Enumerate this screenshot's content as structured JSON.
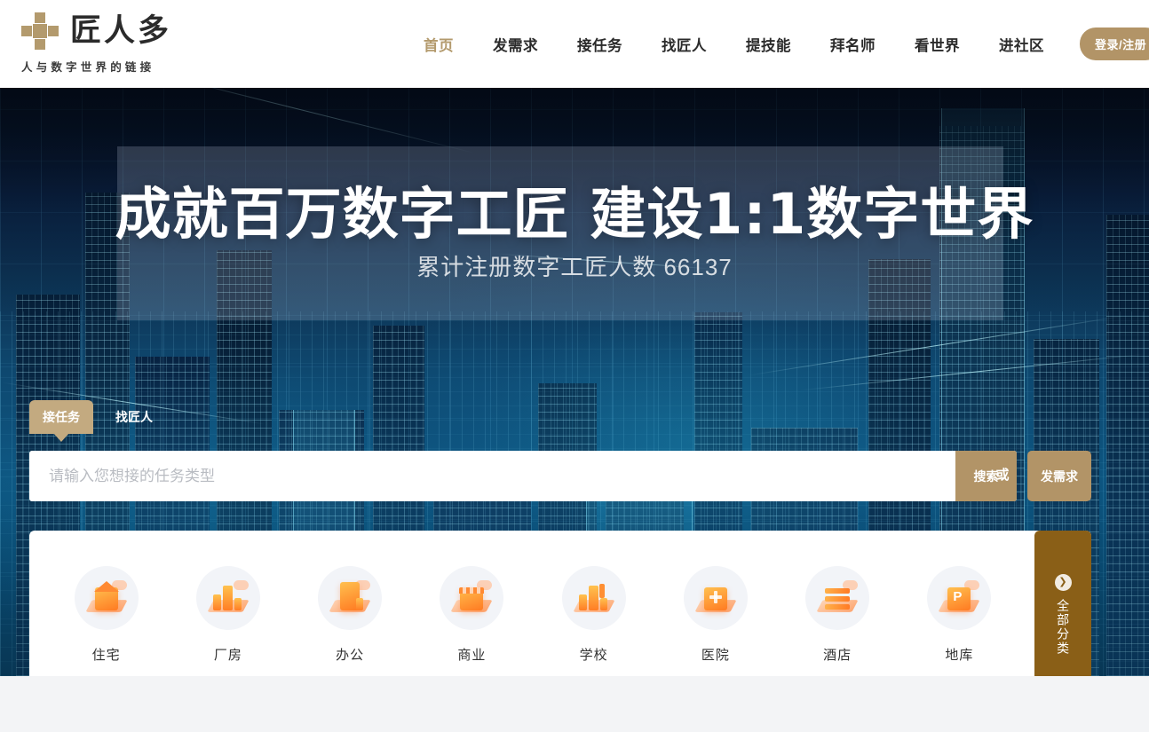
{
  "header": {
    "logo": {
      "name": "匠人多",
      "tagline": "人与数字世界的链接",
      "mark_icon": "cross-blocks-icon"
    },
    "nav": [
      {
        "label": "首页",
        "active": true
      },
      {
        "label": "发需求",
        "active": false
      },
      {
        "label": "接任务",
        "active": false
      },
      {
        "label": "找匠人",
        "active": false
      },
      {
        "label": "提技能",
        "active": false
      },
      {
        "label": "拜名师",
        "active": false
      },
      {
        "label": "看世界",
        "active": false
      },
      {
        "label": "进社区",
        "active": false
      }
    ],
    "login_button": "登录/注册"
  },
  "hero": {
    "title": "成就百万数字工匠  建设1:1数字世界",
    "subtitle": "累计注册数字工匠人数 66137",
    "registered_count": "66137"
  },
  "search": {
    "tabs": [
      {
        "label": "接任务",
        "active": true
      },
      {
        "label": "找匠人",
        "active": false
      }
    ],
    "placeholder": "请输入您想接的任务类型",
    "value": "",
    "search_button": "搜索",
    "or_text": "或",
    "demand_button": "发需求"
  },
  "categories": {
    "items": [
      {
        "label": "住宅",
        "icon": "house-icon"
      },
      {
        "label": "厂房",
        "icon": "factory-icon"
      },
      {
        "label": "办公",
        "icon": "office-icon"
      },
      {
        "label": "商业",
        "icon": "shop-icon"
      },
      {
        "label": "学校",
        "icon": "school-icon"
      },
      {
        "label": "医院",
        "icon": "hospital-icon"
      },
      {
        "label": "酒店",
        "icon": "hotel-icon"
      },
      {
        "label": "地库",
        "icon": "parking-icon"
      }
    ],
    "all_label": "全部分类",
    "all_icon": "chevron-right-circle-icon"
  },
  "colors": {
    "brand_gold": "#b29467",
    "tab_gold": "#c3aa80",
    "all_brown": "#8a5f17",
    "page_bg": "#f3f4f6",
    "icon_orange": "#ff8a33"
  }
}
